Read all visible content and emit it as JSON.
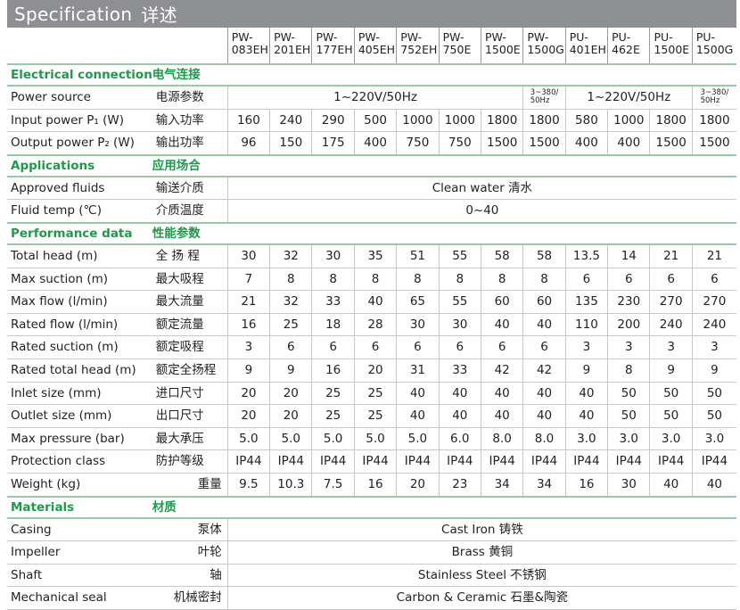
{
  "title": {
    "en": "Specification",
    "cn": "详述"
  },
  "models": [
    [
      "PW-",
      "083EH"
    ],
    [
      "PW-",
      "201EH"
    ],
    [
      "PW-",
      "177EH"
    ],
    [
      "PW-",
      "405EH"
    ],
    [
      "PW-",
      "752EH"
    ],
    [
      "PW-",
      "750E"
    ],
    [
      "PW-",
      "1500E"
    ],
    [
      "PW-",
      "1500G"
    ],
    [
      "PU-",
      "401EH"
    ],
    [
      "PU-",
      "462E"
    ],
    [
      "PU-",
      "1500E"
    ],
    [
      "PU-",
      "1500G"
    ]
  ],
  "sections": {
    "electrical": {
      "en": "Electrical connection",
      "cn": "电气连接"
    },
    "applications": {
      "en": "Applications",
      "cn": "应用场合"
    },
    "performance": {
      "en": "Performance data",
      "cn": "性能参数"
    },
    "materials": {
      "en": "Materials",
      "cn": "材质"
    }
  },
  "power_source": {
    "en": "Power source",
    "cn": "电源参数",
    "a": "1~220V/50Hz",
    "b1": "3~380/",
    "b2": "50Hz",
    "c": "1~220V/50Hz",
    "d1": "3~380/",
    "d2": "50Hz"
  },
  "input_power": {
    "en": "Input power P₁ (W)",
    "cn": "输入功率",
    "values": [
      "160",
      "240",
      "290",
      "500",
      "1000",
      "1000",
      "1800",
      "1800",
      "580",
      "1000",
      "1800",
      "1800"
    ]
  },
  "output_power": {
    "en": "Output power P₂ (W)",
    "cn": "输出功率",
    "values": [
      "96",
      "150",
      "175",
      "400",
      "750",
      "750",
      "1500",
      "1500",
      "400",
      "400",
      "1500",
      "1500"
    ]
  },
  "approved_fluids": {
    "en": "Approved fluids",
    "cn": "输送介质",
    "value": "Clean water  清水"
  },
  "fluid_temp": {
    "en": "Fluid temp (℃)",
    "cn": "介质温度",
    "value": "0~40"
  },
  "perf_rows": [
    {
      "en": "Total head (m)",
      "cn": "全 扬 程",
      "values": [
        "30",
        "32",
        "30",
        "35",
        "51",
        "55",
        "58",
        "58",
        "13.5",
        "14",
        "21",
        "21"
      ]
    },
    {
      "en": "Max suction (m)",
      "cn": "最大吸程",
      "values": [
        "7",
        "8",
        "8",
        "8",
        "8",
        "8",
        "8",
        "8",
        "6",
        "6",
        "6",
        "6"
      ]
    },
    {
      "en": "Max flow (l/min)",
      "cn": "最大流量",
      "values": [
        "21",
        "32",
        "33",
        "40",
        "65",
        "55",
        "60",
        "60",
        "135",
        "230",
        "270",
        "270"
      ]
    },
    {
      "en": "Rated flow (l/min)",
      "cn": "额定流量",
      "values": [
        "16",
        "25",
        "18",
        "28",
        "30",
        "30",
        "40",
        "40",
        "110",
        "200",
        "240",
        "240"
      ]
    },
    {
      "en": "Rated suction (m)",
      "cn": "额定吸程",
      "values": [
        "3",
        "6",
        "6",
        "6",
        "6",
        "6",
        "6",
        "6",
        "3",
        "3",
        "3",
        "3"
      ]
    },
    {
      "en": "Rated total head (m)",
      "cn": "额定全扬程",
      "values": [
        "9",
        "9",
        "16",
        "20",
        "31",
        "33",
        "42",
        "42",
        "9",
        "8",
        "9",
        "9"
      ]
    },
    {
      "en": "Inlet size (mm)",
      "cn": "进口尺寸",
      "values": [
        "20",
        "20",
        "25",
        "25",
        "40",
        "40",
        "40",
        "40",
        "40",
        "50",
        "50",
        "50"
      ]
    },
    {
      "en": "Outlet size (mm)",
      "cn": "出口尺寸",
      "values": [
        "20",
        "20",
        "25",
        "25",
        "40",
        "40",
        "40",
        "40",
        "40",
        "50",
        "50",
        "50"
      ]
    },
    {
      "en": "Max pressure (bar)",
      "cn": "最大承压",
      "values": [
        "5.0",
        "5.0",
        "5.0",
        "5.0",
        "5.0",
        "6.0",
        "8.0",
        "8.0",
        "3.0",
        "3.0",
        "3.0",
        "3.0"
      ]
    },
    {
      "en": "Protection class",
      "cn": "防护等级",
      "values": [
        "IP44",
        "IP44",
        "IP44",
        "IP44",
        "IP44",
        "IP44",
        "IP44",
        "IP44",
        "IP44",
        "IP44",
        "IP44",
        "IP44"
      ]
    },
    {
      "en": "Weight  (kg)",
      "cn": "重量",
      "values": [
        "9.5",
        "10.3",
        "7.5",
        "16",
        "20",
        "23",
        "34",
        "34",
        "16",
        "30",
        "40",
        "40"
      ]
    }
  ],
  "material_rows": [
    {
      "en": "Casing",
      "cn": "泵体",
      "value": "Cast Iron  铸铁"
    },
    {
      "en": "Impeller",
      "cn": "叶轮",
      "value": "Brass  黄铜"
    },
    {
      "en": "Shaft",
      "cn": "轴",
      "value": "Stainless Steel  不锈钢"
    },
    {
      "en": "Mechanical seal",
      "cn": "机械密封",
      "value": "Carbon & Ceramic  石墨&陶瓷"
    }
  ],
  "colors": {
    "title_bar": "#8d8f93",
    "section_text": "#1d9a4a",
    "section_rule": "#9ac9a9"
  }
}
